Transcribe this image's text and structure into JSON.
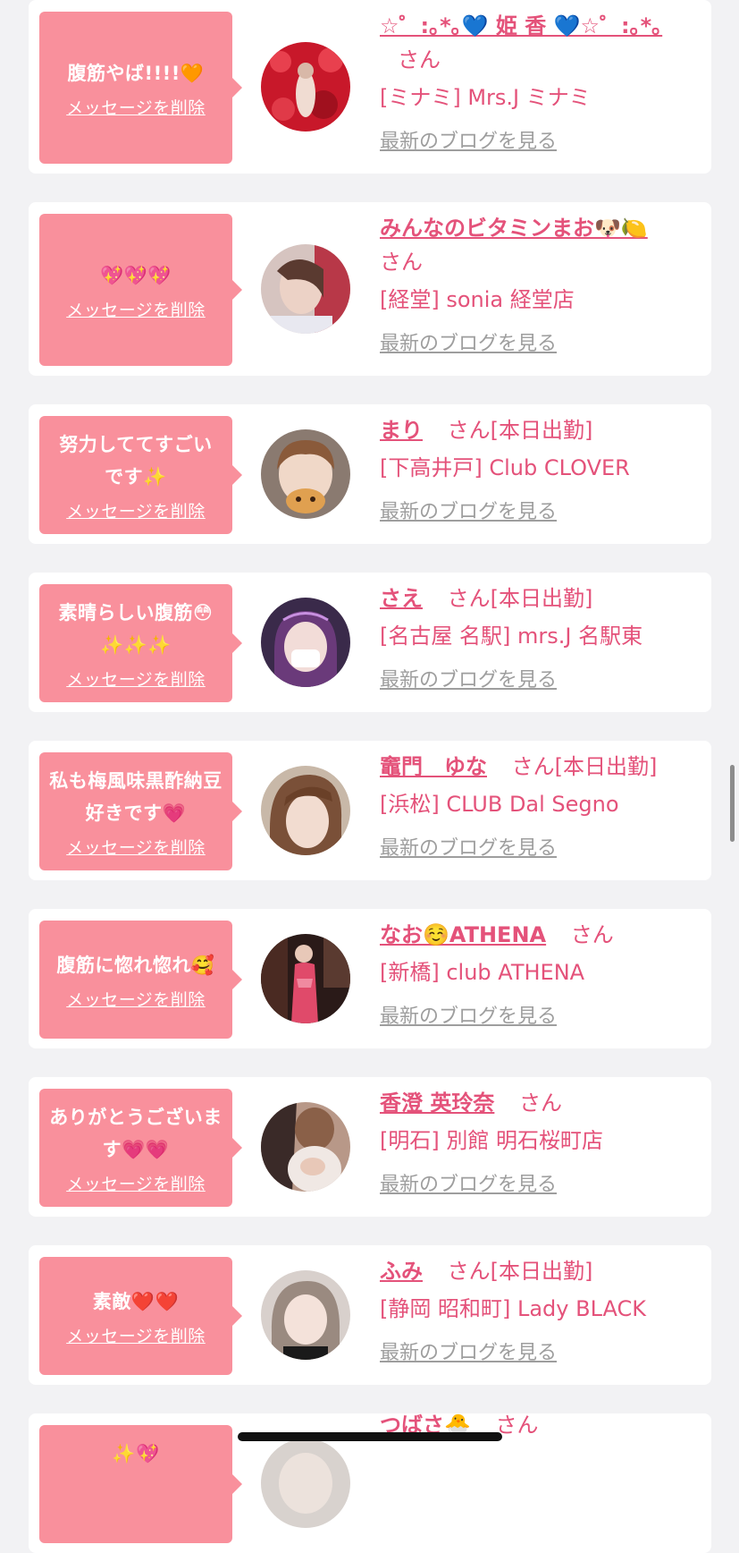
{
  "delete_label": "メッセージを削除",
  "blog_label": "最新のブログを見る",
  "honorific": "さん",
  "colors": {
    "page_background": "#f2f2f4",
    "bubble": "#f9909c",
    "accent_text": "#e4527a",
    "link_gray": "#9e9e9e"
  },
  "messages": [
    {
      "message": "腹筋やば!!!!🧡",
      "name": "☆゜:｡*｡💙 姫 香 💙☆゜:｡*｡",
      "suffix": "さん",
      "shop": "[ミナミ] Mrs.J ミナミ",
      "avatar_icon": "avatar-photo-icon"
    },
    {
      "message": "💖💖💖",
      "name": "みんなのビタミンまお🐶🍋",
      "suffix": "さん",
      "shop": "[経堂] sonia 経堂店",
      "avatar_icon": "avatar-photo-icon"
    },
    {
      "message": "努力しててすごいです✨",
      "name": "まり",
      "suffix": "さん[本日出勤]",
      "shop": "[下高井戸] Club CLOVER",
      "avatar_icon": "avatar-photo-icon"
    },
    {
      "message": "素晴らしい腹筋😳✨✨✨",
      "name": "さえ",
      "suffix": "さん[本日出勤]",
      "shop": "[名古屋 名駅] mrs.J 名駅東",
      "avatar_icon": "avatar-photo-icon"
    },
    {
      "message": "私も梅風味黒酢納豆好きです💗",
      "name": "竈門　ゆな",
      "suffix": "さん[本日出勤]",
      "shop": "[浜松] CLUB Dal Segno",
      "avatar_icon": "avatar-photo-icon"
    },
    {
      "message": "腹筋に惚れ惚れ🥰",
      "name": "なお☺️ATHENA",
      "suffix": "さん",
      "shop": "[新橋] club ATHENA",
      "avatar_icon": "avatar-photo-icon"
    },
    {
      "message": "ありがとうございます💗💗",
      "name": "香澄 英玲奈",
      "suffix": "さん",
      "shop": "[明石] 別館 明石桜町店",
      "avatar_icon": "avatar-photo-icon"
    },
    {
      "message": "素敵❤️❤️",
      "name": "ふみ",
      "suffix": "さん[本日出勤]",
      "shop": "[静岡 昭和町] Lady BLACK",
      "avatar_icon": "avatar-photo-icon"
    },
    {
      "message": "✨💖",
      "name": "つばさ🐣",
      "suffix": "さん",
      "shop": "",
      "avatar_icon": "avatar-photo-icon"
    }
  ]
}
